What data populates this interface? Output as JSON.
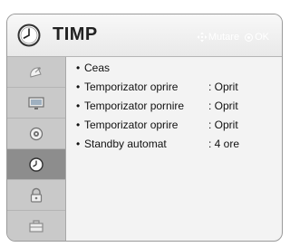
{
  "header": {
    "title": "TIMP",
    "hints": {
      "move_label": "Mutare",
      "ok_label": "OK"
    }
  },
  "icons": {
    "header_icon": "clock-icon",
    "hint_move_icon": "navigation-arrows-icon",
    "hint_ok_icon": "ok-button-icon"
  },
  "sidebar": {
    "items": [
      {
        "name": "satellite-dish-icon",
        "active": false
      },
      {
        "name": "monitor-icon",
        "active": false
      },
      {
        "name": "audio-icon",
        "active": false
      },
      {
        "name": "clock-icon",
        "active": true
      },
      {
        "name": "lock-icon",
        "active": false
      },
      {
        "name": "briefcase-icon",
        "active": false
      }
    ]
  },
  "menu": {
    "bullet": "•",
    "items": [
      {
        "label": "Ceas",
        "value": ""
      },
      {
        "label": "Temporizator oprire",
        "value": ": Oprit"
      },
      {
        "label": "Temporizator pornire",
        "value": ": Oprit"
      },
      {
        "label": "Temporizator oprire",
        "value": ": Oprit"
      },
      {
        "label": "Standby automat",
        "value": ": 4 ore"
      }
    ]
  },
  "colors": {
    "frame_bg": "#f3f3f3",
    "sidebar_bg": "#c9c9c9",
    "sidebar_active_bg": "#8d8d8d",
    "hint_text": "#ffffff"
  }
}
